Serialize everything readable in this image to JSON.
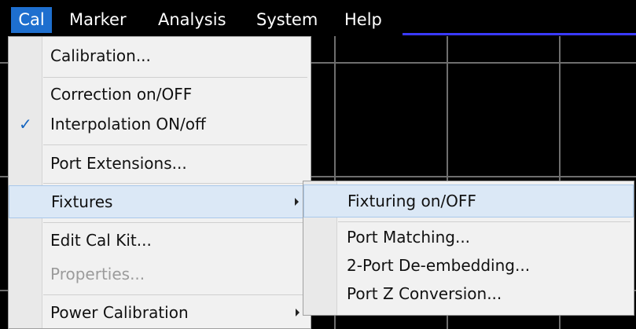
{
  "menubar": {
    "items": [
      "Cal",
      "Marker",
      "Analysis",
      "System",
      "Help"
    ],
    "active": "Cal",
    "accent_color": "#1e6fcf"
  },
  "cal_menu": {
    "items": [
      {
        "label": "Calibration...",
        "checked": false,
        "disabled": false,
        "submenu": false
      },
      {
        "label": "Correction on/OFF",
        "checked": false,
        "disabled": false,
        "submenu": false
      },
      {
        "label": "Interpolation ON/off",
        "checked": true,
        "disabled": false,
        "submenu": false
      },
      {
        "label": "Port Extensions...",
        "checked": false,
        "disabled": false,
        "submenu": false
      },
      {
        "label": "Fixtures",
        "checked": false,
        "disabled": false,
        "submenu": true,
        "highlighted": true
      },
      {
        "label": "Edit Cal Kit...",
        "checked": false,
        "disabled": false,
        "submenu": false
      },
      {
        "label": "Properties...",
        "checked": false,
        "disabled": true,
        "submenu": false
      },
      {
        "label": "Power Calibration",
        "checked": false,
        "disabled": false,
        "submenu": true
      }
    ],
    "check_glyph": "✓"
  },
  "fixtures_submenu": {
    "items": [
      {
        "label": "Fixturing on/OFF",
        "highlighted": true
      },
      {
        "label": "Port Matching..."
      },
      {
        "label": "2-Port De-embedding..."
      },
      {
        "label": "Port Z Conversion..."
      }
    ]
  }
}
